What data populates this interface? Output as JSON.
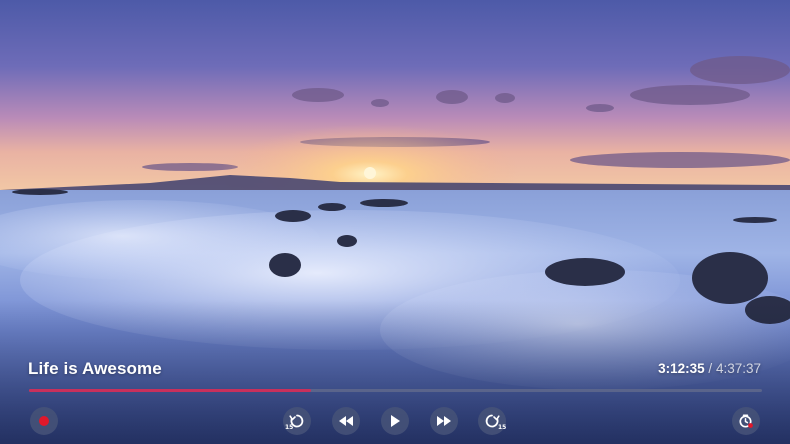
{
  "player": {
    "title": "Life is Awesome",
    "current_time": "3:12:35",
    "separator": "/",
    "total_time": "4:37:37",
    "progress_fraction": 0.385,
    "accent_color": "#c8305c",
    "track_color": "#5f698c"
  },
  "controls": {
    "record_icon": "record-icon",
    "replay_icon": "replay-15-icon",
    "replay_seconds": "15",
    "rewind_icon": "rewind-icon",
    "play_icon": "play-icon",
    "fast_forward_icon": "fast-forward-icon",
    "skip_icon": "skip-15-icon",
    "skip_seconds": "15",
    "timer_icon": "sleep-timer-icon"
  }
}
